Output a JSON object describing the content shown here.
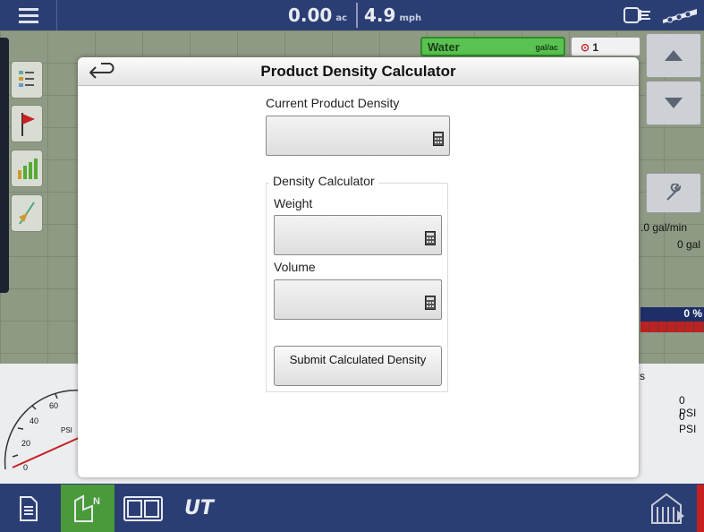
{
  "topbar": {
    "menu_icon": "hamburger-menu-icon",
    "area_value": "0.00",
    "area_unit": "ac",
    "speed_value": "4.9",
    "speed_unit": "mph"
  },
  "map": {
    "product_name": "Water",
    "product_unit": "gal/ac",
    "counter": "1",
    "left_buttons": [
      "layers-icon",
      "flag-icon",
      "chart-icon",
      "guidance-icon"
    ],
    "right_flow": ".0 gal/min",
    "right_total": "0 gal",
    "progress_label": "0 %"
  },
  "lower": {
    "gauge_ticks": [
      "60",
      "40",
      "20",
      "0"
    ],
    "gauge_unit": "PSI",
    "right_label": "s",
    "pressure_1": "0 PSI",
    "pressure_2": "0 PSI"
  },
  "dialog": {
    "title": "Product Density Calculator",
    "back_icon": "back-arrow-icon",
    "current_label": "Current Product Density",
    "current_value": "",
    "group_title": "Density Calculator",
    "weight_label": "Weight",
    "weight_value": "",
    "volume_label": "Volume",
    "volume_value": "",
    "submit_label": "Submit Calculated Density"
  },
  "bottombar": {
    "items": [
      "document-icon",
      "field-map-icon",
      "split-screen-icon"
    ],
    "ut_label": "UT",
    "right_icon": "run-screen-icon"
  },
  "colors": {
    "header_blue": "#2b3e74",
    "water_green": "#59c250",
    "active_tab": "#4a9a3a"
  }
}
